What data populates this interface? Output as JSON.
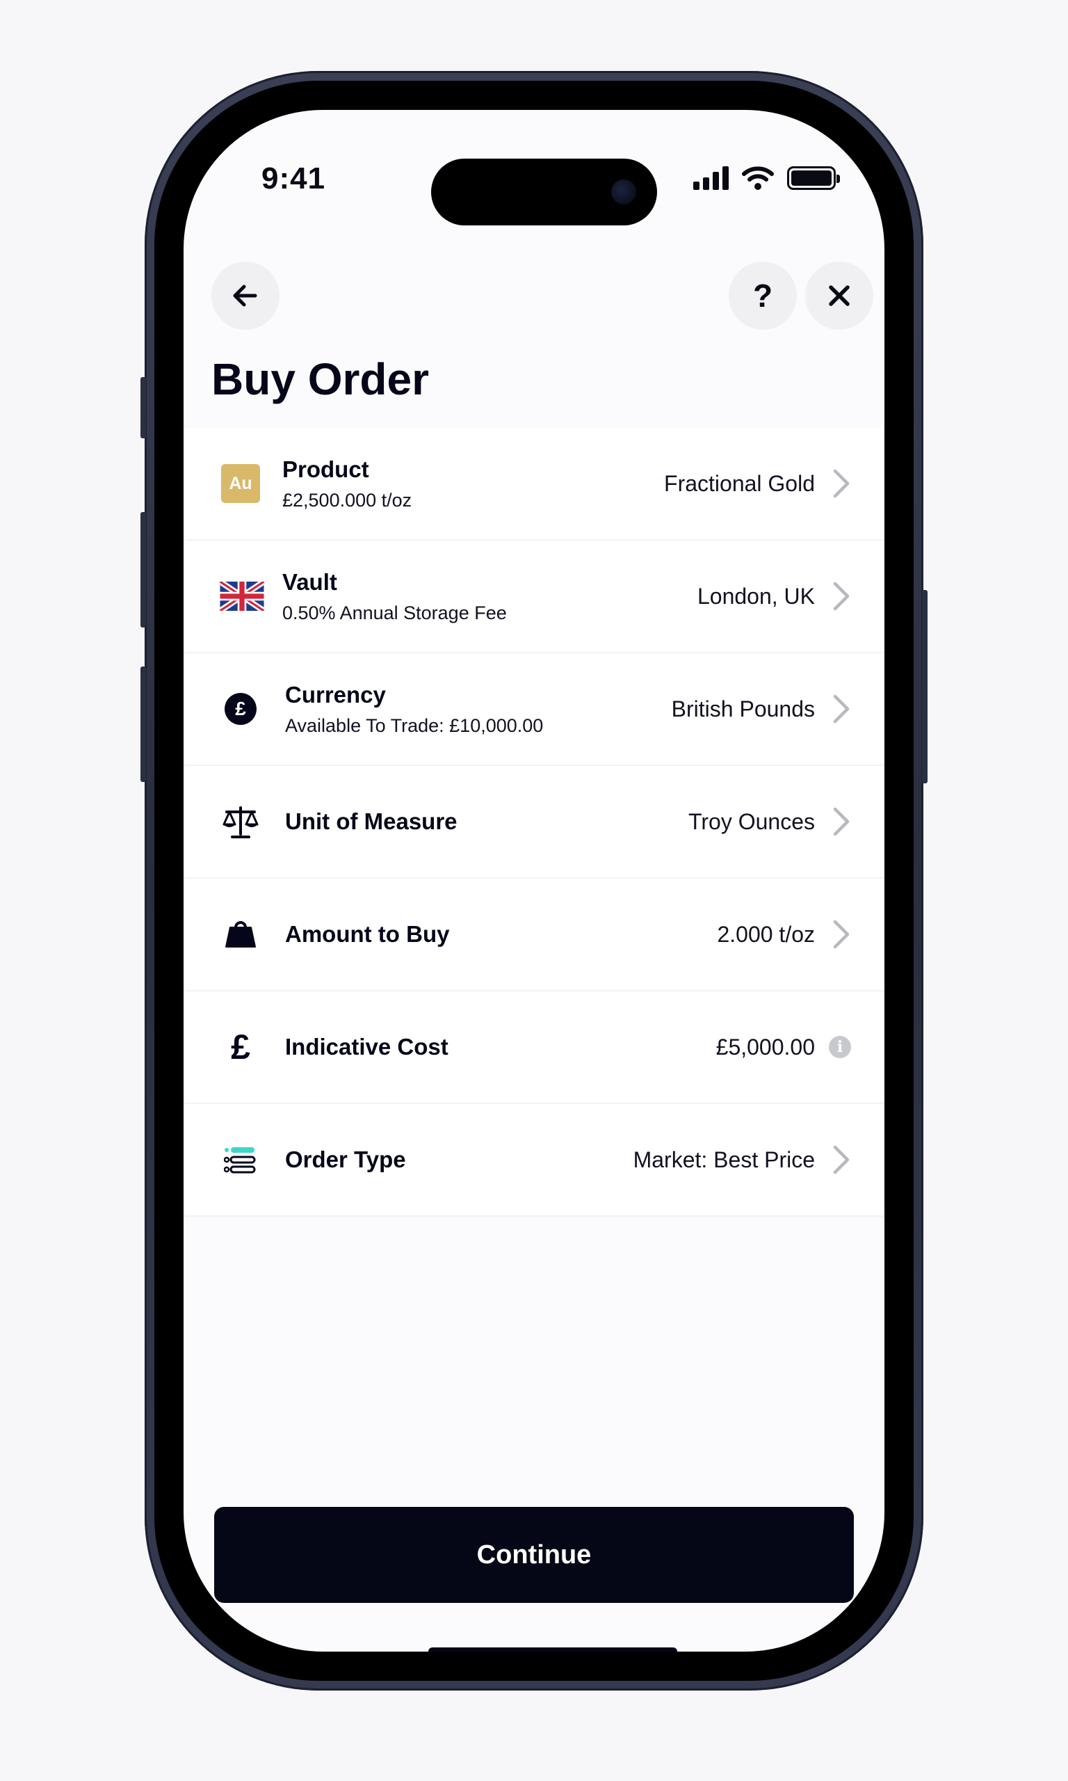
{
  "status_bar": {
    "time": "9:41"
  },
  "header": {
    "title": "Buy Order"
  },
  "nav": {
    "back_glyph": "←",
    "help_glyph": "?",
    "close_glyph": "✕"
  },
  "rows": [
    {
      "icon": "gold-au-badge-icon",
      "icon_text": "Au",
      "title": "Product",
      "subtitle": "£2,500.000 t/oz",
      "value": "Fractional Gold",
      "action": "chevron"
    },
    {
      "icon": "uk-flag-icon",
      "title": "Vault",
      "subtitle": "0.50% Annual Storage Fee",
      "value": "London, UK",
      "action": "chevron"
    },
    {
      "icon": "pound-circle-icon",
      "icon_text": "£",
      "title": "Currency",
      "subtitle": "Available To Trade: £10,000.00",
      "value": "British Pounds",
      "action": "chevron"
    },
    {
      "icon": "scales-icon",
      "title": "Unit of Measure",
      "value": "Troy Ounces",
      "action": "chevron"
    },
    {
      "icon": "weight-icon",
      "title": "Amount to Buy",
      "value": "2.000 t/oz",
      "action": "chevron"
    },
    {
      "icon": "pound-sign-icon",
      "icon_text": "£",
      "title": "Indicative Cost",
      "value": "£5,000.00",
      "action": "info"
    },
    {
      "icon": "order-list-icon",
      "title": "Order Type",
      "value": "Market: Best Price",
      "action": "chevron"
    }
  ],
  "info_glyph": "i",
  "footer": {
    "continue_label": "Continue"
  },
  "colors": {
    "accent_dark": "#050716",
    "gold": "#d9b86a",
    "teal": "#3fd6c8",
    "background": "#fbfbfd"
  }
}
